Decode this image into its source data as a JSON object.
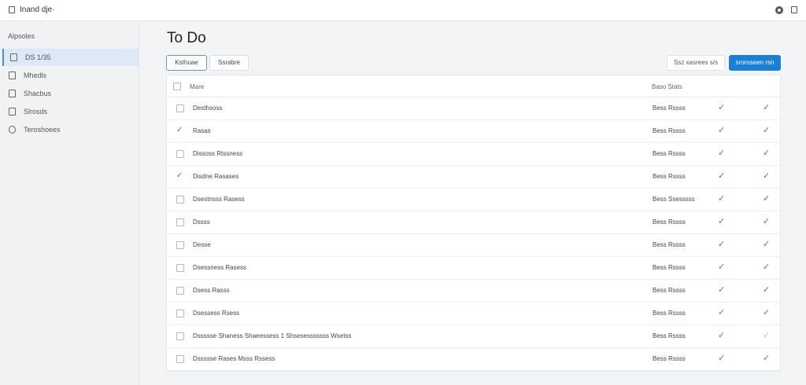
{
  "topbar": {
    "title": "Inand dje·"
  },
  "sidebar": {
    "section_label": "Alpsoles",
    "items": [
      {
        "label": "DS 1/35",
        "active": true
      },
      {
        "label": "Mhedls",
        "active": false
      },
      {
        "label": "Shacbus",
        "active": false
      },
      {
        "label": "Slrosds",
        "active": false
      },
      {
        "label": "Teroshoees",
        "active": false
      }
    ]
  },
  "main": {
    "title": "To Do",
    "tabs": [
      {
        "label": "Ksthuae",
        "selected": true
      },
      {
        "label": "Ssrabre",
        "selected": false
      }
    ],
    "search_label": "Ssz xasrees s/s",
    "primary_button": "sroroseen rsn"
  },
  "table": {
    "columns": {
      "name": "Mare",
      "status": "Baso Stats"
    },
    "rows": [
      {
        "name": "Desthsoss",
        "status": "Bess Rssss",
        "checked": false,
        "mark2_faint": false
      },
      {
        "name": "Rasas",
        "status": "Bess Rssss",
        "checked": true,
        "mark2_faint": false
      },
      {
        "name": "Dissoss Rtssness",
        "status": "Bess Rssss",
        "checked": false,
        "mark2_faint": false
      },
      {
        "name": "Disdne Rasases",
        "status": "Bess Rssss",
        "checked": true,
        "mark2_faint": false
      },
      {
        "name": "Dsestnsss Rasess",
        "status": "Bess Ssesssss",
        "checked": false,
        "mark2_faint": false
      },
      {
        "name": "Dssss",
        "status": "Bess Rssss",
        "checked": false,
        "mark2_faint": false
      },
      {
        "name": "Desse",
        "status": "Bess Rssss",
        "checked": false,
        "mark2_faint": false
      },
      {
        "name": "Dsessness Rasess",
        "status": "Bess Rssss",
        "checked": false,
        "mark2_faint": false
      },
      {
        "name": "Dsess Rasss",
        "status": "Bess Rssss",
        "checked": false,
        "mark2_faint": false
      },
      {
        "name": "Dsessess Rsess",
        "status": "Bess Rssss",
        "checked": false,
        "mark2_faint": false
      },
      {
        "name": "Dssssse Shaness Shaeessess 1 Shsesesssssss Wsetss",
        "status": "Bess Rssss",
        "checked": false,
        "mark2_faint": true
      },
      {
        "name": "Dssssse Rases Msss Rssess",
        "status": "Bess Rssss",
        "checked": false,
        "mark2_faint": false
      }
    ]
  },
  "icons": {
    "check": "✓",
    "app": "window-icon",
    "user": "user-icon"
  }
}
